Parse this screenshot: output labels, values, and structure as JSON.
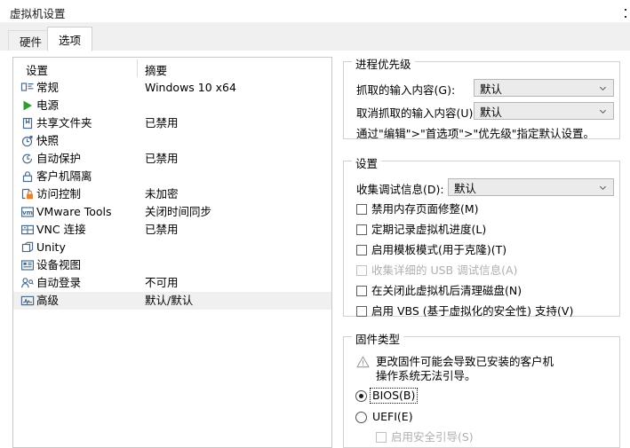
{
  "window": {
    "title": "虚拟机设置"
  },
  "tabs": [
    {
      "label": "硬件",
      "active": false
    },
    {
      "label": "选项",
      "active": true
    }
  ],
  "settings_list": {
    "columns": {
      "settings": "设置",
      "summary": "摘要"
    },
    "rows": [
      {
        "icon": "monitor-icon",
        "label": "常规",
        "summary": "Windows 10 x64",
        "selected": false
      },
      {
        "icon": "power-icon",
        "label": "电源",
        "summary": "",
        "selected": false
      },
      {
        "icon": "shared-folder-icon",
        "label": "共享文件夹",
        "summary": "已禁用",
        "selected": false
      },
      {
        "icon": "snapshot-icon",
        "label": "快照",
        "summary": "",
        "selected": false
      },
      {
        "icon": "autoprotect-icon",
        "label": "自动保护",
        "summary": "已禁用",
        "selected": false
      },
      {
        "icon": "guest-isolation-icon",
        "label": "客户机隔离",
        "summary": "",
        "selected": false
      },
      {
        "icon": "access-control-icon",
        "label": "访问控制",
        "summary": "未加密",
        "selected": false
      },
      {
        "icon": "vmware-tools-icon",
        "label": "VMware Tools",
        "summary": "关闭时间同步",
        "selected": false
      },
      {
        "icon": "vnc-icon",
        "label": "VNC 连接",
        "summary": "已禁用",
        "selected": false
      },
      {
        "icon": "unity-icon",
        "label": "Unity",
        "summary": "",
        "selected": false
      },
      {
        "icon": "device-view-icon",
        "label": "设备视图",
        "summary": "",
        "selected": false
      },
      {
        "icon": "auto-login-icon",
        "label": "自动登录",
        "summary": "不可用",
        "selected": false
      },
      {
        "icon": "advanced-icon",
        "label": "高级",
        "summary": "默认/默认",
        "selected": true
      }
    ]
  },
  "priority_group": {
    "title": "进程优先级",
    "grab_label": "抓取的输入内容(G):",
    "grab_value": "默认",
    "ungrab_label": "取消抓取的输入内容(U):",
    "ungrab_value": "默认",
    "hint": "通过\"编辑\">\"首选项\">\"优先级\"指定默认设置。"
  },
  "settings_group": {
    "title": "设置",
    "debug_label": "收集调试信息(D):",
    "debug_value": "默认",
    "checkboxes": [
      {
        "label": "禁用内存页面修整(M)",
        "checked": false,
        "enabled": true
      },
      {
        "label": "定期记录虚拟机进度(L)",
        "checked": false,
        "enabled": true
      },
      {
        "label": "启用模板模式(用于克隆)(T)",
        "checked": false,
        "enabled": true
      },
      {
        "label": "收集详细的 USB 调试信息(A)",
        "checked": false,
        "enabled": false
      },
      {
        "label": "在关闭此虚拟机后清理磁盘(N)",
        "checked": false,
        "enabled": true
      },
      {
        "label": "启用 VBS (基于虚拟化的安全性) 支持(V)",
        "checked": false,
        "enabled": true
      }
    ]
  },
  "firmware_group": {
    "title": "固件类型",
    "warning_line1": "更改固件可能会导致已安装的客户机",
    "warning_line2": "操作系统无法引导。",
    "options": [
      {
        "label": "BIOS(B)",
        "selected": true,
        "focused": true
      },
      {
        "label": "UEFI(E)",
        "selected": false,
        "focused": false
      }
    ],
    "secure_boot": {
      "label": "启用安全引导(S)",
      "checked": false,
      "enabled": false
    }
  },
  "colors": {
    "window_bg": "#ffffff",
    "tabstrip_bg": "#f0f0f0",
    "selection_bg": "#f0f0f0",
    "border": "#c8c8c8",
    "group_border": "#d2d2d2",
    "combo_bg": "#ebebeb",
    "disabled_text": "#b0b0b0",
    "power_green": "#2f9e2f",
    "lock_orange": "#e8832a",
    "icon_blue": "#4a6b8a"
  }
}
